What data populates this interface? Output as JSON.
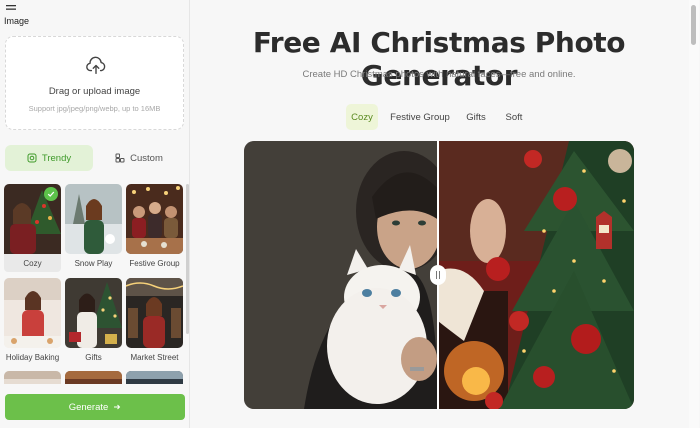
{
  "sidebar": {
    "logo_text": "Image",
    "upload": {
      "title": "Drag or upload image",
      "hint": "Support jpg/jpeg/png/webp, up to 16MB"
    },
    "mode_tabs": [
      {
        "label": "Trendy",
        "icon": "frame-icon",
        "active": true
      },
      {
        "label": "Custom",
        "icon": "custom-icon",
        "active": false
      }
    ],
    "templates": [
      {
        "label": "Cozy",
        "selected": true
      },
      {
        "label": "Snow Play",
        "selected": false
      },
      {
        "label": "Festive Group",
        "selected": false
      },
      {
        "label": "Holiday Baking",
        "selected": false
      },
      {
        "label": "Gifts",
        "selected": false
      },
      {
        "label": "Market Street",
        "selected": false
      }
    ],
    "generate_label": "Generate"
  },
  "main": {
    "title": "Free AI Christmas Photo Generator",
    "subtitle": "Create HD Christmas photos with natural faces—free and online.",
    "styles": [
      {
        "label": "Cozy",
        "active": true
      },
      {
        "label": "Festive Group",
        "active": false
      },
      {
        "label": "Gifts",
        "active": false
      },
      {
        "label": "Soft",
        "active": false
      }
    ]
  },
  "colors": {
    "accent": "#6cc04a",
    "accent_text": "#3f9a2a",
    "active_tab_bg": "#e3f2d7"
  }
}
